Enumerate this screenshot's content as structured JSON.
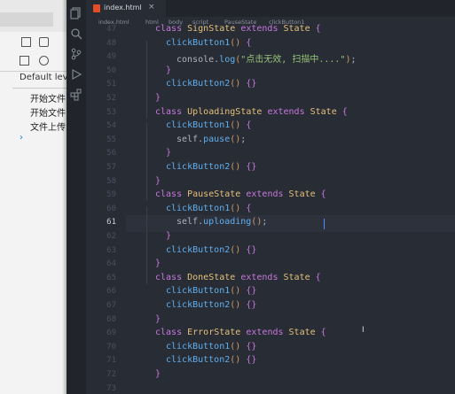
{
  "devtools": {
    "level_label": "Default level",
    "messages": [
      "开始文件",
      "开始文件",
      "文件上传"
    ]
  },
  "editor": {
    "tab_name": "index.html",
    "tab_close": "×",
    "breadcrumb": [
      "index.html",
      "html",
      "body",
      "script",
      "PauseState",
      "clickButton1"
    ],
    "lines": [
      {
        "n": "47",
        "indent": 1,
        "tokens": [
          [
            "kw",
            "class "
          ],
          [
            "cls",
            "SignState"
          ],
          [
            "kw",
            " extends "
          ],
          [
            "cls",
            "State"
          ],
          [
            "plain",
            " "
          ],
          [
            "br",
            "{"
          ]
        ]
      },
      {
        "n": "48",
        "indent": 2,
        "tokens": [
          [
            "fn",
            "clickButton1"
          ],
          [
            "br2",
            "()"
          ],
          [
            "plain",
            " "
          ],
          [
            "br",
            "{"
          ]
        ]
      },
      {
        "n": "49",
        "indent": 3,
        "tokens": [
          [
            "plain",
            "console."
          ],
          [
            "fn",
            "log"
          ],
          [
            "br2",
            "("
          ],
          [
            "str",
            "\"点击无效, 扫描中....\""
          ],
          [
            "br2",
            ")"
          ],
          [
            "plain",
            ";"
          ]
        ]
      },
      {
        "n": "50",
        "indent": 2,
        "tokens": [
          [
            "br",
            "}"
          ]
        ]
      },
      {
        "n": "51",
        "indent": 2,
        "tokens": [
          [
            "fn",
            "clickButton2"
          ],
          [
            "br2",
            "()"
          ],
          [
            "plain",
            " "
          ],
          [
            "br",
            "{}"
          ]
        ]
      },
      {
        "n": "52",
        "indent": 1,
        "tokens": [
          [
            "br",
            "}"
          ]
        ]
      },
      {
        "n": "53",
        "indent": 1,
        "tokens": [
          [
            "kw",
            "class "
          ],
          [
            "cls",
            "UploadingState"
          ],
          [
            "kw",
            " extends "
          ],
          [
            "cls",
            "State"
          ],
          [
            "plain",
            " "
          ],
          [
            "br",
            "{"
          ]
        ]
      },
      {
        "n": "54",
        "indent": 2,
        "tokens": [
          [
            "fn",
            "clickButton1"
          ],
          [
            "br2",
            "()"
          ],
          [
            "plain",
            " "
          ],
          [
            "br",
            "{"
          ]
        ]
      },
      {
        "n": "55",
        "indent": 3,
        "tokens": [
          [
            "plain",
            "self."
          ],
          [
            "fn",
            "pause"
          ],
          [
            "br2",
            "()"
          ],
          [
            "plain",
            ";"
          ]
        ]
      },
      {
        "n": "56",
        "indent": 2,
        "tokens": [
          [
            "br",
            "}"
          ]
        ]
      },
      {
        "n": "57",
        "indent": 2,
        "tokens": [
          [
            "fn",
            "clickButton2"
          ],
          [
            "br2",
            "()"
          ],
          [
            "plain",
            " "
          ],
          [
            "br",
            "{}"
          ]
        ]
      },
      {
        "n": "58",
        "indent": 1,
        "tokens": [
          [
            "br",
            "}"
          ]
        ]
      },
      {
        "n": "59",
        "indent": 1,
        "tokens": [
          [
            "kw",
            "class "
          ],
          [
            "cls",
            "PauseState"
          ],
          [
            "kw",
            " extends "
          ],
          [
            "cls",
            "State"
          ],
          [
            "plain",
            " "
          ],
          [
            "br",
            "{"
          ]
        ]
      },
      {
        "n": "60",
        "indent": 2,
        "tokens": [
          [
            "fn",
            "clickButton1"
          ],
          [
            "br2",
            "()"
          ],
          [
            "plain",
            " "
          ],
          [
            "br",
            "{"
          ]
        ]
      },
      {
        "n": "61",
        "indent": 3,
        "tokens": [
          [
            "plain",
            "self."
          ],
          [
            "fn",
            "uploading"
          ],
          [
            "br2",
            "()"
          ],
          [
            "plain",
            ";"
          ]
        ]
      },
      {
        "n": "62",
        "indent": 2,
        "tokens": [
          [
            "br",
            "}"
          ]
        ]
      },
      {
        "n": "63",
        "indent": 2,
        "tokens": [
          [
            "fn",
            "clickButton2"
          ],
          [
            "br2",
            "()"
          ],
          [
            "plain",
            " "
          ],
          [
            "br",
            "{}"
          ]
        ]
      },
      {
        "n": "64",
        "indent": 1,
        "tokens": [
          [
            "br",
            "}"
          ]
        ]
      },
      {
        "n": "65",
        "indent": 1,
        "tokens": [
          [
            "kw",
            "class "
          ],
          [
            "cls",
            "DoneState"
          ],
          [
            "kw",
            " extends "
          ],
          [
            "cls",
            "State"
          ],
          [
            "plain",
            " "
          ],
          [
            "br",
            "{"
          ]
        ]
      },
      {
        "n": "66",
        "indent": 2,
        "tokens": [
          [
            "fn",
            "clickButton1"
          ],
          [
            "br2",
            "()"
          ],
          [
            "plain",
            " "
          ],
          [
            "br",
            "{}"
          ]
        ]
      },
      {
        "n": "67",
        "indent": 2,
        "tokens": [
          [
            "fn",
            "clickButton2"
          ],
          [
            "br2",
            "()"
          ],
          [
            "plain",
            " "
          ],
          [
            "br",
            "{}"
          ]
        ]
      },
      {
        "n": "68",
        "indent": 1,
        "tokens": [
          [
            "br",
            "}"
          ]
        ]
      },
      {
        "n": "69",
        "indent": 1,
        "tokens": [
          [
            "kw",
            "class "
          ],
          [
            "cls",
            "ErrorState"
          ],
          [
            "kw",
            " extends "
          ],
          [
            "cls",
            "State"
          ],
          [
            "plain",
            " "
          ],
          [
            "br",
            "{"
          ]
        ]
      },
      {
        "n": "70",
        "indent": 2,
        "tokens": [
          [
            "fn",
            "clickButton1"
          ],
          [
            "br2",
            "()"
          ],
          [
            "plain",
            " "
          ],
          [
            "br",
            "{}"
          ]
        ]
      },
      {
        "n": "71",
        "indent": 2,
        "tokens": [
          [
            "fn",
            "clickButton2"
          ],
          [
            "br2",
            "()"
          ],
          [
            "plain",
            " "
          ],
          [
            "br",
            "{}"
          ]
        ]
      },
      {
        "n": "72",
        "indent": 1,
        "tokens": [
          [
            "br",
            "}"
          ]
        ]
      },
      {
        "n": "73",
        "indent": 0,
        "tokens": []
      }
    ],
    "active_line": "61"
  },
  "icons": {
    "files": "files-icon",
    "search": "search-icon",
    "source_control": "source-control-icon",
    "run_debug": "run-debug-icon",
    "extensions": "extensions-icon",
    "html_file": "html-file-icon"
  }
}
